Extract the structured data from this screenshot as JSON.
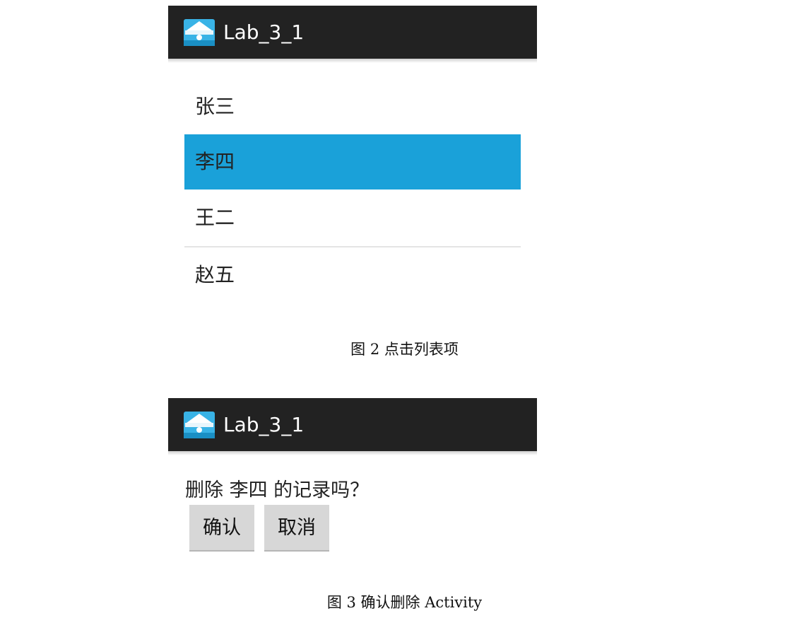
{
  "screen1": {
    "app_title": "Lab_3_1",
    "app_icon": "inbox-tray-icon",
    "list_items": [
      {
        "label": "张三",
        "selected": false
      },
      {
        "label": "李四",
        "selected": true
      },
      {
        "label": "王二",
        "selected": false
      },
      {
        "label": "赵五",
        "selected": false
      }
    ],
    "selected_color": "#1aa1d9"
  },
  "caption1": "图 2  点击列表项",
  "screen2": {
    "app_title": "Lab_3_1",
    "app_icon": "inbox-tray-icon",
    "question": "删除 李四 的记录吗？",
    "confirm_label": "确认",
    "cancel_label": "取消"
  },
  "caption2": "图 3  确认删除 Activity",
  "colors": {
    "actionbar": "#222222",
    "button": "#d7d7d7"
  }
}
